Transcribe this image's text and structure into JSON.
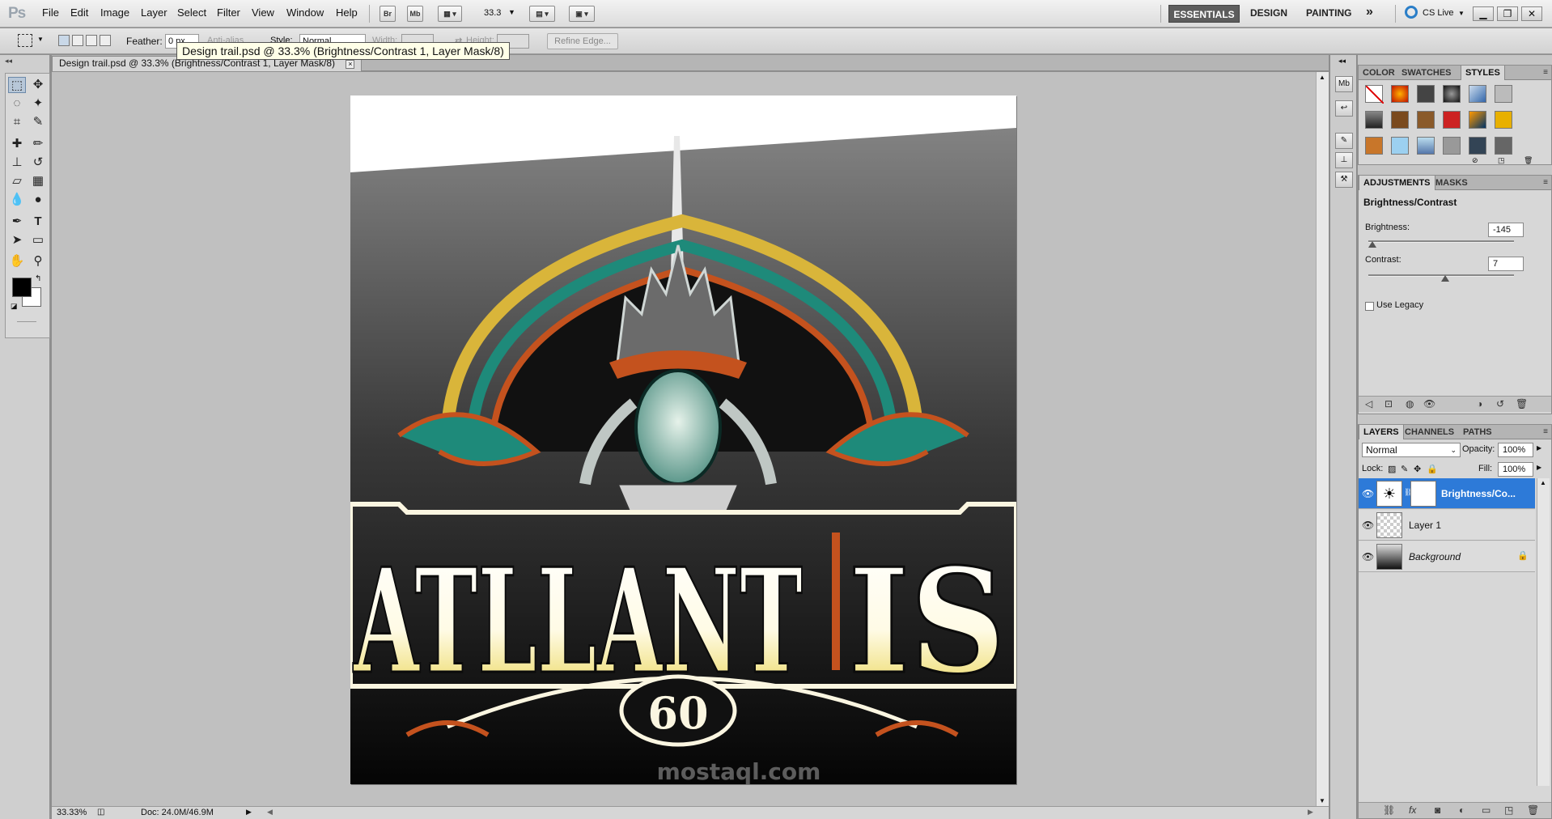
{
  "app": {
    "logo": "Ps",
    "menus": [
      "File",
      "Edit",
      "Image",
      "Layer",
      "Select",
      "Filter",
      "View",
      "Window",
      "Help"
    ],
    "bridge_button": "Br",
    "minibridge_button": "Mb",
    "zoom_value": "33.3",
    "workspaces": [
      "ESSENTIALS",
      "DESIGN",
      "PAINTING"
    ],
    "more_workspaces": "»",
    "cs_live": "CS Live",
    "window_controls": [
      "▁",
      "❐",
      "✕"
    ]
  },
  "options": {
    "feather_label": "Feather:",
    "feather_value": "0 px",
    "antialias_label": "Anti-alias",
    "style_label": "Style:",
    "style_value": "Normal",
    "width_label": "Width:",
    "height_label": "Height:",
    "refine_edge": "Refine Edge..."
  },
  "tooltip": "Design trail.psd @ 33.3% (Brightness/Contrast 1, Layer Mask/8)",
  "document": {
    "tab_title": "Design trail.psd @ 33.3% (Brightness/Contrast 1, Layer Mask/8)",
    "close": "×"
  },
  "artwork": {
    "title_left": "ATLLANT",
    "title_right": "IS",
    "badge": "60"
  },
  "status": {
    "zoom": "33.33%",
    "doc": "Doc: 24.0M/46.9M"
  },
  "panels": {
    "styles_tabs": [
      "COLOR",
      "SWATCHES",
      "STYLES"
    ],
    "adjust_tabs": [
      "ADJUSTMENTS",
      "MASKS"
    ],
    "adjustment_title": "Brightness/Contrast",
    "brightness_label": "Brightness:",
    "brightness_value": "-145",
    "brightness_fraction": 0.03,
    "contrast_label": "Contrast:",
    "contrast_value": "7",
    "contrast_fraction": 0.53,
    "use_legacy": "Use Legacy",
    "layers_tabs": [
      "LAYERS",
      "CHANNELS",
      "PATHS"
    ],
    "blend_mode": "Normal",
    "opacity_label": "Opacity:",
    "opacity_value": "100%",
    "lock_label": "Lock:",
    "fill_label": "Fill:",
    "fill_value": "100%",
    "layers": [
      {
        "name": "Brightness/Co..."
      },
      {
        "name": "Layer 1"
      },
      {
        "name": "Background"
      }
    ]
  },
  "watermark": "mostaql.com",
  "colors": {
    "selection": "#2d7ad8",
    "gold": "#d9b53a",
    "teal": "#1e8a7a",
    "rust": "#c4521e"
  }
}
